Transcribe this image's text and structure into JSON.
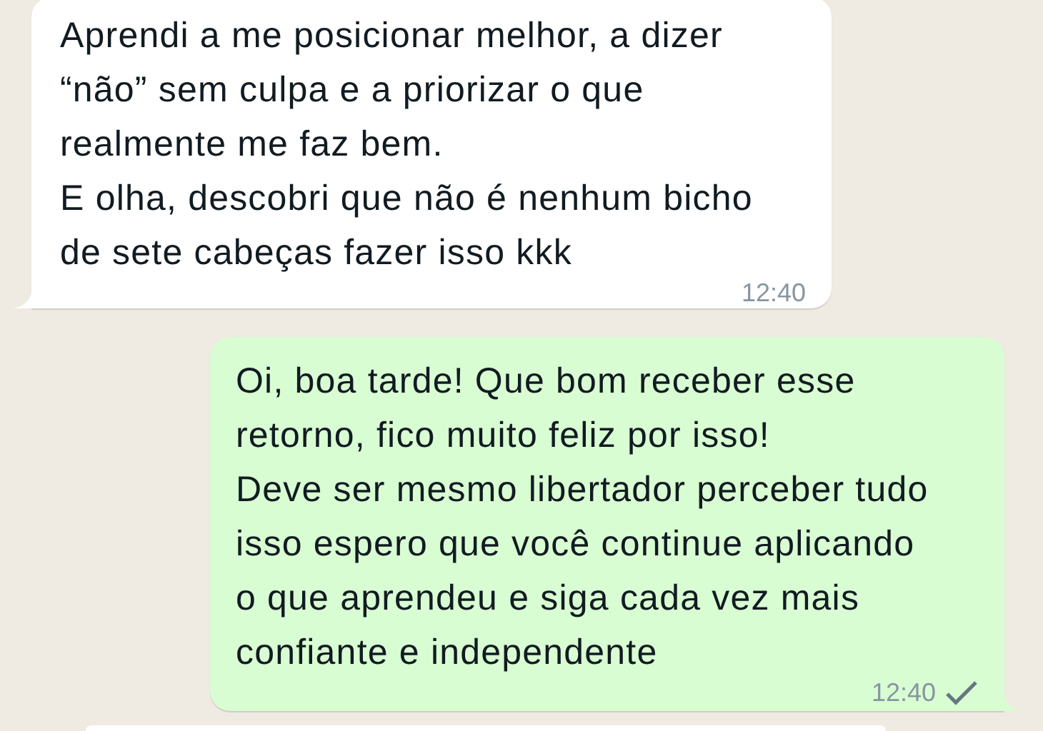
{
  "messages": [
    {
      "kind": "in",
      "paragraphs": [
        "Aprendi a me posicionar melhor, a dizer “não” sem culpa e a priorizar o que realmente me faz bem.",
        "E olha, descobri que não é nenhum bicho de sete cabeças fazer isso kkk"
      ],
      "time": "12:40"
    },
    {
      "kind": "out",
      "paragraphs": [
        "Oi, boa tarde! Que bom receber esse retorno, fico muito feliz por isso!",
        "Deve ser mesmo libertador perceber tudo isso espero que você continue aplicando o que aprendeu e siga cada vez mais confiante e independente"
      ],
      "time": "12:40",
      "sent": true
    }
  ]
}
